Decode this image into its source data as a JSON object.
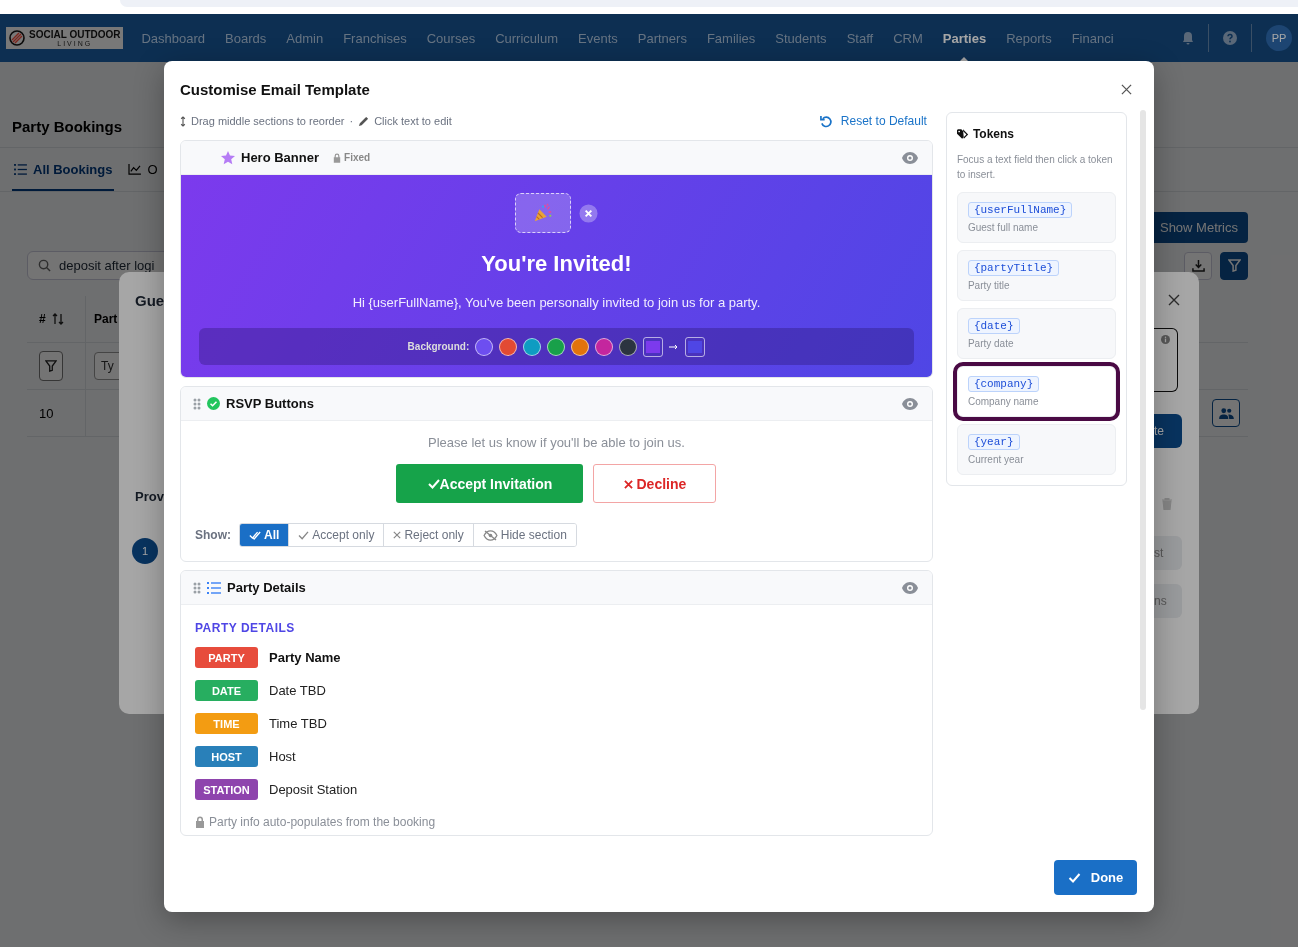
{
  "nav": {
    "logo_text": "SOCIAL OUTDOOR",
    "logo_subtext": "LIVING",
    "items": [
      {
        "label": "Dashboard",
        "selected": false
      },
      {
        "label": "Boards",
        "selected": false
      },
      {
        "label": "Admin",
        "selected": false
      },
      {
        "label": "Franchises",
        "selected": false
      },
      {
        "label": "Courses",
        "selected": false
      },
      {
        "label": "Curriculum",
        "selected": false
      },
      {
        "label": "Events",
        "selected": false
      },
      {
        "label": "Partners",
        "selected": false
      },
      {
        "label": "Families",
        "selected": false
      },
      {
        "label": "Students",
        "selected": false
      },
      {
        "label": "Staff",
        "selected": false
      },
      {
        "label": "CRM",
        "selected": false
      },
      {
        "label": "Parties",
        "selected": true
      },
      {
        "label": "Reports",
        "selected": false
      },
      {
        "label": "Financi",
        "selected": false
      }
    ],
    "avatar": "PP"
  },
  "page": {
    "title": "Party Bookings",
    "tabs": [
      {
        "label": "All Bookings",
        "selected": true
      },
      {
        "label": "O",
        "selected": false
      }
    ],
    "show_metrics": "Show Metrics",
    "search": {
      "value": "deposit after logi"
    },
    "table": {
      "columns": [
        "#",
        "Part"
      ],
      "filter_placeholder": "Ty",
      "rows": [
        [
          "10"
        ]
      ]
    }
  },
  "guest_dialog": {
    "title": "Gue",
    "section": "Prov",
    "step": "1",
    "button_fragments": [
      "te",
      "st",
      "ns"
    ]
  },
  "modal": {
    "title": "Customise Email Template",
    "hint_drag": "Drag middle sections to reorder",
    "hint_separator": "·",
    "hint_click": "Click text to edit",
    "reset": "Reset to Default",
    "sections": [
      {
        "kind": "hero",
        "title": "Hero Banner",
        "badge": "Fixed",
        "draggable": false,
        "heading": "You're Invited!",
        "message": "Hi {userFullName}, You've been personally invited to join us for a party.",
        "background_label": "Background:",
        "swatches": [
          {
            "color": "#6d4ef0"
          },
          {
            "color": "#e24a33"
          },
          {
            "color": "#0e9cc2"
          },
          {
            "color": "#18a04a"
          },
          {
            "color": "#e2730c"
          },
          {
            "color": "#c4269e"
          },
          {
            "color": "#2b3440"
          }
        ]
      },
      {
        "kind": "rsvp",
        "title": "RSVP Buttons",
        "draggable": true,
        "prompt": "Please let us know if you'll be able to join us.",
        "accept": "Accept Invitation",
        "decline": "Decline",
        "show_label": "Show:",
        "options": [
          {
            "label": "All",
            "selected": true
          },
          {
            "label": "Accept only",
            "selected": false
          },
          {
            "label": "Reject only",
            "selected": false
          },
          {
            "label": "Hide section",
            "selected": false
          }
        ]
      },
      {
        "kind": "details",
        "title": "Party Details",
        "draggable": true,
        "heading": "PARTY DETAILS",
        "rows": [
          {
            "tag": "PARTY",
            "color": "#e74c3c",
            "value": "Party Name",
            "bold": true
          },
          {
            "tag": "DATE",
            "color": "#27ae60",
            "value": "Date TBD",
            "bold": false
          },
          {
            "tag": "TIME",
            "color": "#f39c12",
            "value": "Time TBD",
            "bold": false
          },
          {
            "tag": "HOST",
            "color": "#2980b9",
            "value": "Host",
            "bold": false
          },
          {
            "tag": "STATION",
            "color": "#8e44ad",
            "value": "Deposit Station",
            "bold": false
          }
        ],
        "note": "Party info auto-populates from the booking"
      }
    ],
    "tokens": {
      "title": "Tokens",
      "hint": "Focus a text field then click a token to insert.",
      "items": [
        {
          "token": "{userFullName}",
          "description": "Guest full name",
          "focused": false
        },
        {
          "token": "{partyTitle}",
          "description": "Party title",
          "focused": false
        },
        {
          "token": "{date}",
          "description": "Party date",
          "focused": false
        },
        {
          "token": "{company}",
          "description": "Company name",
          "focused": true
        },
        {
          "token": "{year}",
          "description": "Current year",
          "focused": false
        }
      ]
    },
    "done": "Done"
  }
}
